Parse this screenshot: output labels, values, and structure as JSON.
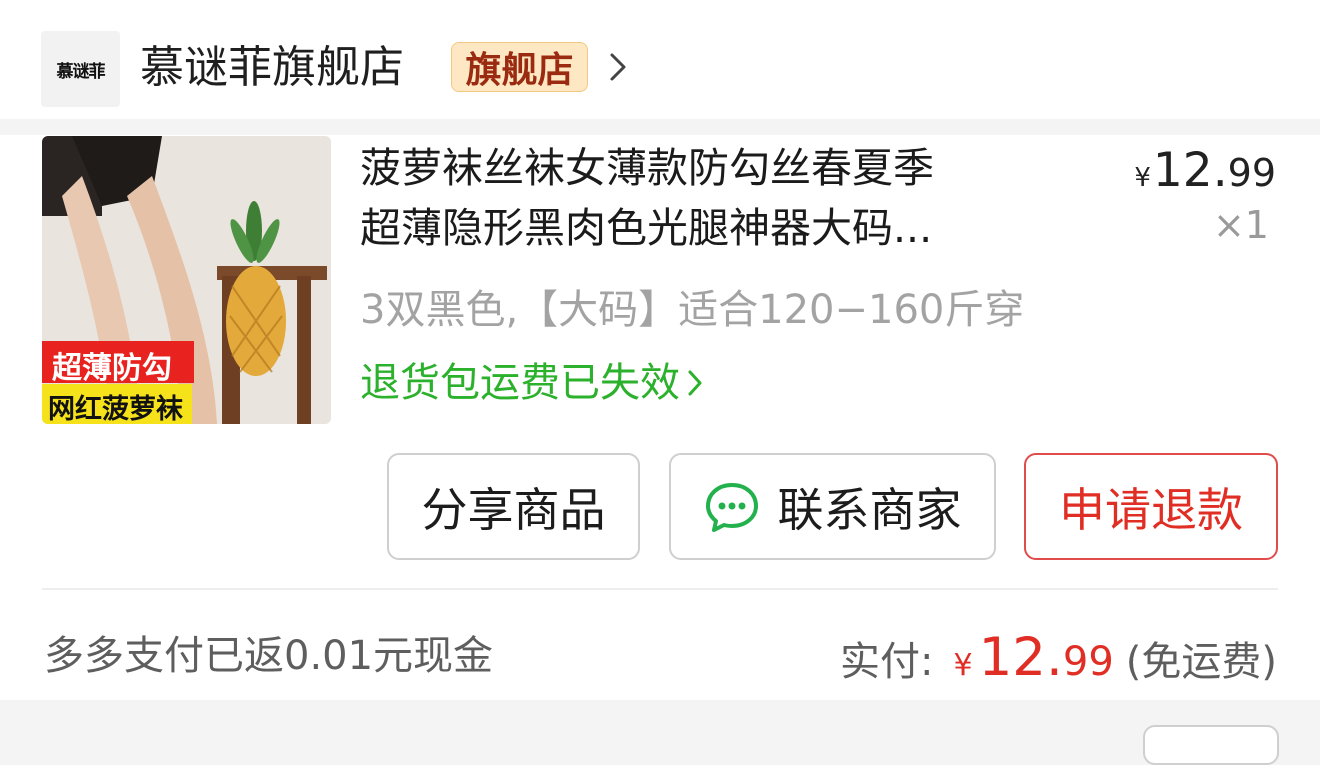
{
  "store": {
    "logo_text": "慕谜菲",
    "name": "慕谜菲旗舰店",
    "badge": "旗舰店"
  },
  "product": {
    "title_line1": "菠萝袜丝袜女薄款防勾丝春夏季",
    "title_line2": "超薄隐形黑肉色光腿神器大码...",
    "image_caption_top": "超薄防勾",
    "image_caption_bottom": "网红菠萝袜",
    "price_symbol": "¥",
    "price_int": "12.",
    "price_dec": "99",
    "quantity": "×1",
    "spec": "3双黑色,【大码】适合120−160斤穿",
    "notice": "退货包运费已失效"
  },
  "actions": {
    "share": "分享商品",
    "contact": "联系商家",
    "refund": "申请退款"
  },
  "footer": {
    "cashback": "多多支付已返0.01元现金",
    "paid_label": "实付:",
    "paid_symbol": "¥",
    "paid_int": "12.",
    "paid_dec": "99",
    "shipping": "(免运费)"
  },
  "colors": {
    "accent_red": "#e02e24",
    "notice_green": "#2bb12b",
    "badge_bg": "#fde8c3",
    "badge_text": "#9b2b10",
    "wechat_green": "#22b14c"
  },
  "icons": {
    "store_chevron": "chevron-right-icon",
    "notice_chevron": "chevron-right-icon",
    "contact": "chat-bubble-icon"
  }
}
